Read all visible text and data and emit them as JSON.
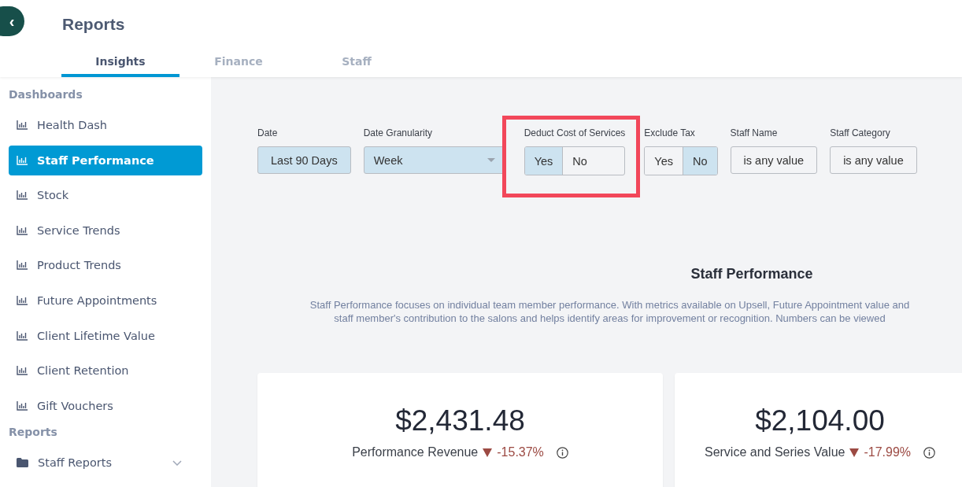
{
  "header": {
    "back_icon": "‹",
    "title": "Reports"
  },
  "tabs": [
    {
      "label": "Insights",
      "selected": true
    },
    {
      "label": "Finance",
      "selected": false
    },
    {
      "label": "Staff",
      "selected": false
    }
  ],
  "sidebar": {
    "sections": [
      {
        "title": "Dashboards",
        "items": [
          {
            "label": "Health Dash",
            "kind": "chart",
            "selected": false
          },
          {
            "label": "Staff Performance",
            "kind": "chart",
            "selected": true
          },
          {
            "label": "Stock",
            "kind": "chart",
            "selected": false
          },
          {
            "label": "Service Trends",
            "kind": "chart",
            "selected": false
          },
          {
            "label": "Product Trends",
            "kind": "chart",
            "selected": false
          },
          {
            "label": "Future Appointments",
            "kind": "chart",
            "selected": false
          },
          {
            "label": "Client Lifetime Value",
            "kind": "chart",
            "selected": false
          },
          {
            "label": "Client Retention",
            "kind": "chart",
            "selected": false
          },
          {
            "label": "Gift Vouchers",
            "kind": "chart",
            "selected": false
          }
        ]
      },
      {
        "title": "Reports",
        "items": [
          {
            "label": "Staff Reports",
            "kind": "folder",
            "selected": false,
            "expanded": false
          }
        ]
      }
    ]
  },
  "filters": [
    {
      "kind": "button",
      "label": "Date",
      "value": "Last 90 Days",
      "highlighted": false
    },
    {
      "kind": "dropdown",
      "label": "Date Granularity",
      "value": "Week",
      "highlighted": false
    },
    {
      "kind": "toggle",
      "label": "Deduct Cost of Services",
      "highlighted": true,
      "options": [
        {
          "label": "Yes",
          "selected": true
        },
        {
          "label": "No",
          "selected": false
        }
      ]
    },
    {
      "kind": "toggle",
      "label": "Exclude Tax",
      "highlighted": false,
      "options": [
        {
          "label": "Yes",
          "selected": false
        },
        {
          "label": "No",
          "selected": true
        }
      ]
    },
    {
      "kind": "text",
      "label": "Staff Name",
      "value": "is any value",
      "highlighted": false
    },
    {
      "kind": "text",
      "label": "Staff Category",
      "value": "is any value",
      "highlighted": false
    }
  ],
  "dashboard": {
    "title": "Staff Performance",
    "description": [
      "Staff Performance focuses on individual team member performance. With metrics available on Upsell, Future Appointment value and",
      "staff member's contribution to the salons and helps identify areas for improvement or recognition. Numbers can be viewed"
    ],
    "metrics": [
      {
        "value": "$2,431.48",
        "label": "Performance Revenue",
        "negative": true,
        "change": "-15.37%"
      },
      {
        "value": "$2,104.00",
        "label": "Service and Series Value",
        "negative": true,
        "change": "-17.99%"
      }
    ]
  }
}
